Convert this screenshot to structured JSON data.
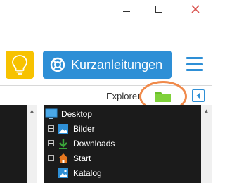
{
  "toolbar": {
    "guide_label": "Kurzanleitungen"
  },
  "explorer": {
    "title": "Explorer",
    "tree": {
      "root": {
        "label": "Desktop",
        "icon": "desktop-icon"
      },
      "items": [
        {
          "label": "Bilder",
          "icon": "pictures-icon"
        },
        {
          "label": "Downloads",
          "icon": "downloads-icon"
        },
        {
          "label": "Start",
          "icon": "home-icon"
        },
        {
          "label": "Katalog",
          "icon": "catalog-icon"
        }
      ]
    }
  },
  "colors": {
    "accent_blue": "#2e8fd6",
    "bulb_yellow": "#f7c200",
    "highlight_orange": "#f08a4b",
    "close_red": "#d9534f",
    "folder_green": "#6bbf2a",
    "downloads_green": "#3aa43a",
    "home_orange": "#e6771f"
  }
}
